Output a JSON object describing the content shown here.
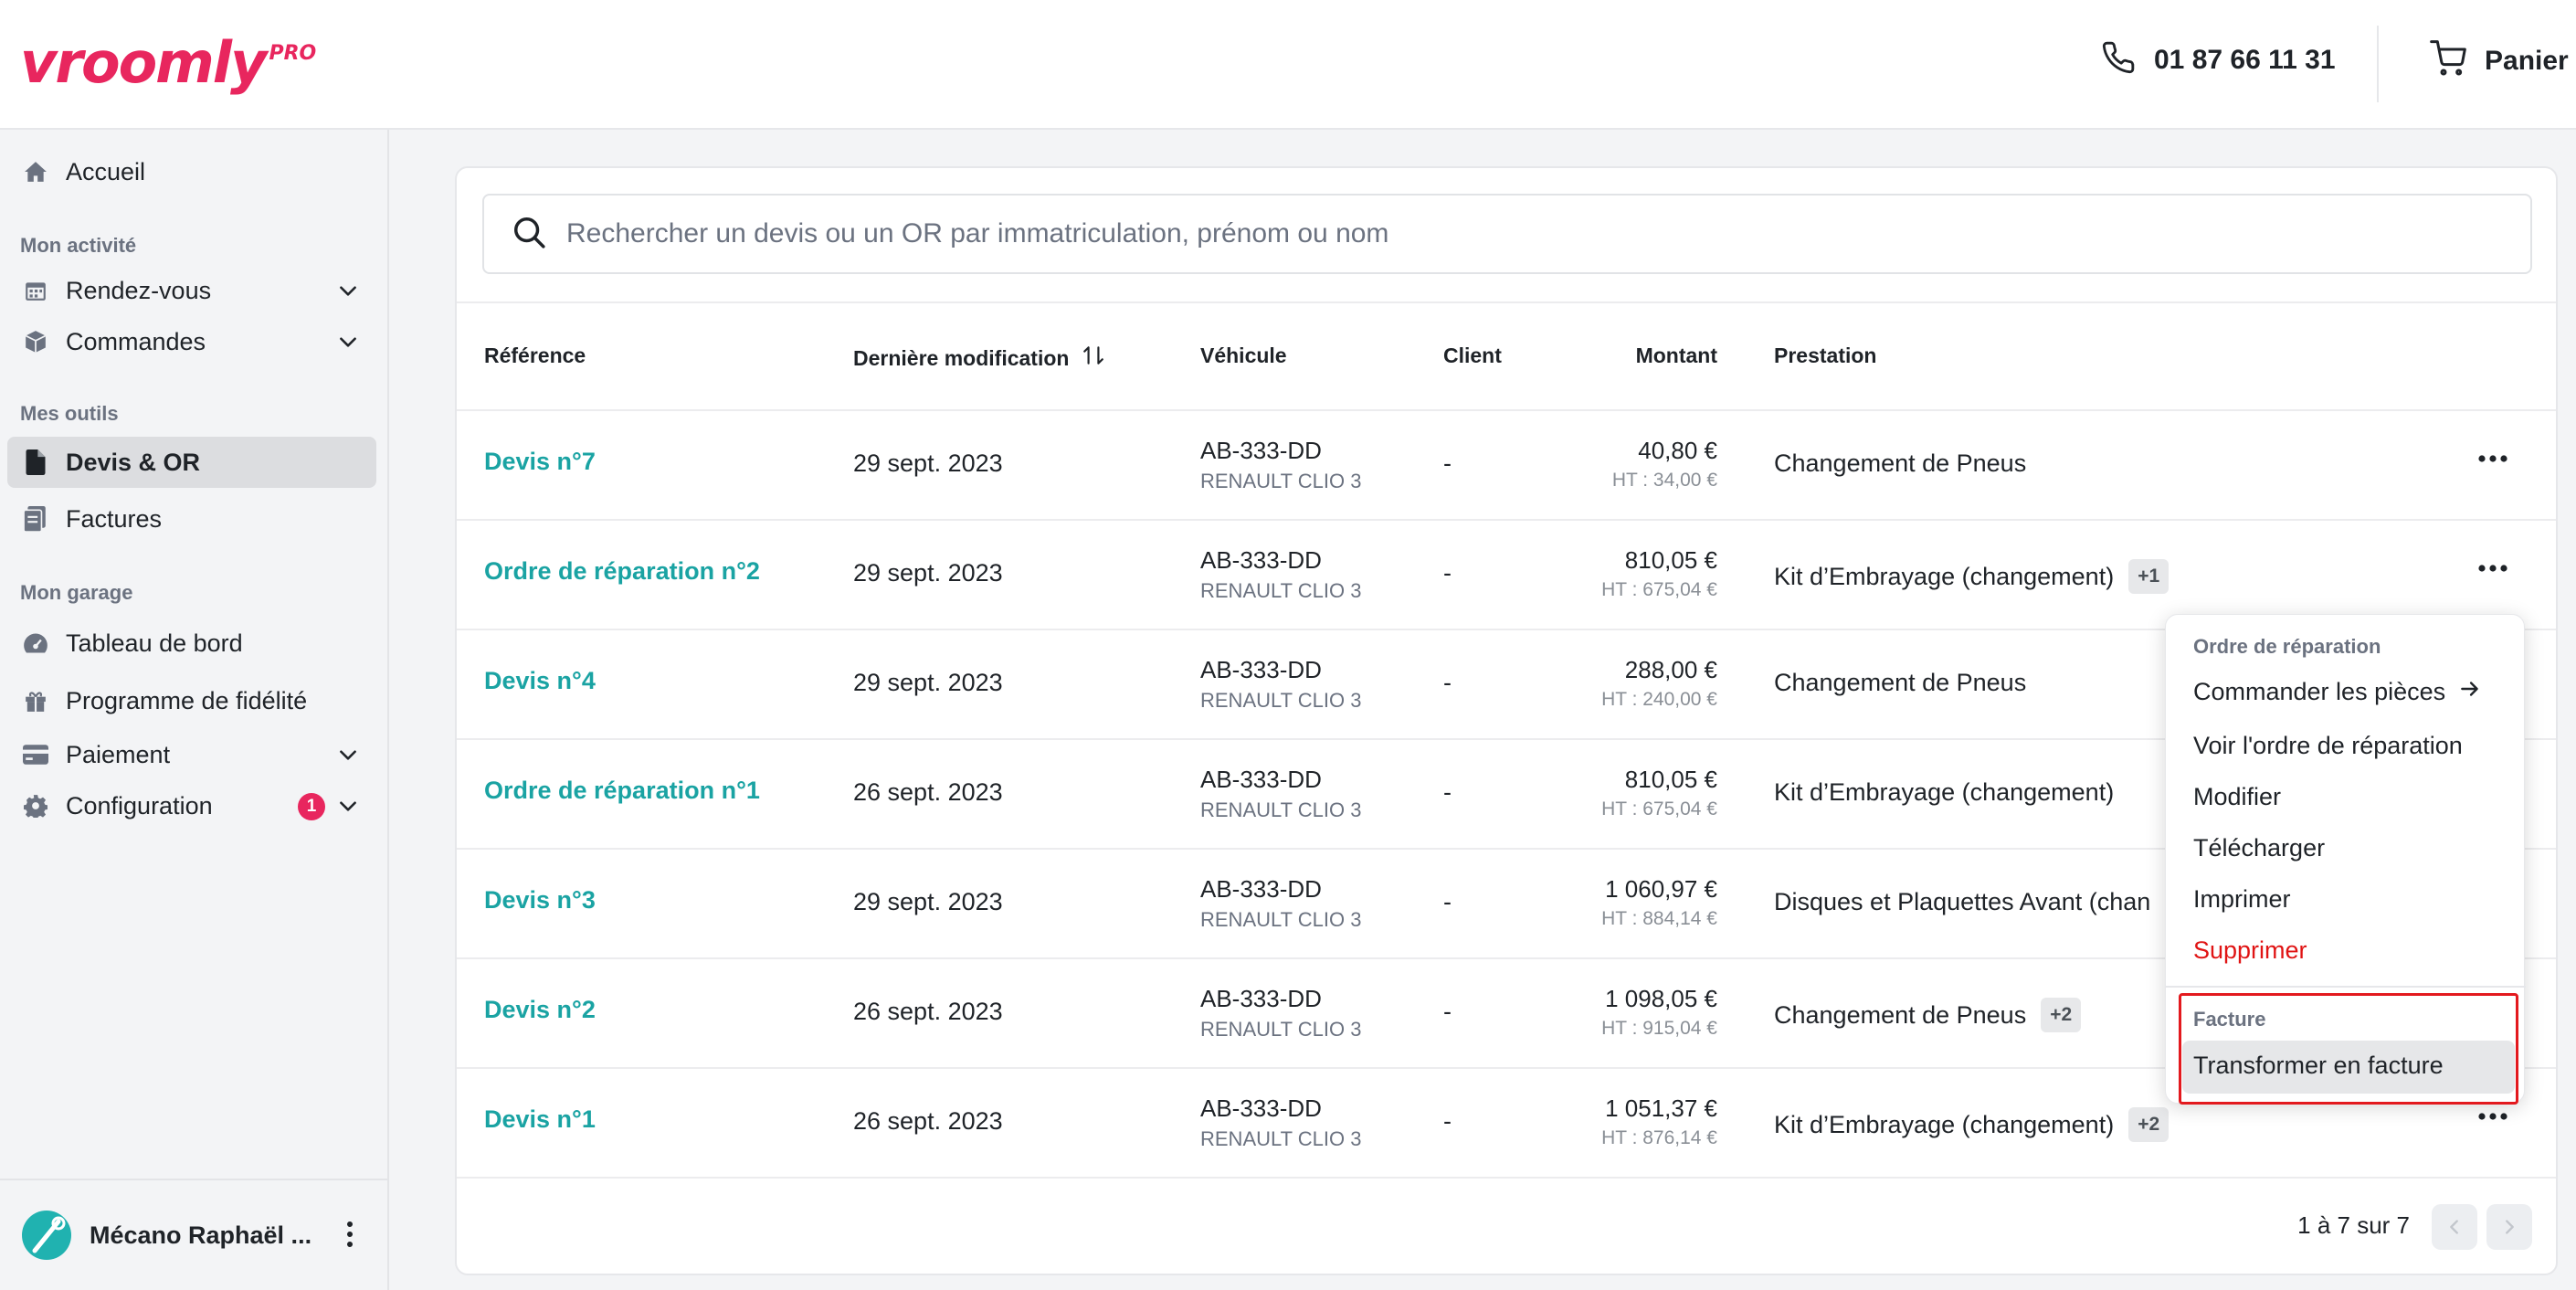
{
  "brand": {
    "name": "vroomly",
    "suffix": "PRO",
    "color": "#e8265e"
  },
  "header": {
    "phone": "01 87 66 11 31",
    "cart_label": "Panier"
  },
  "sidebar": {
    "home": "Accueil",
    "section_activity": "Mon activité",
    "appointments": "Rendez-vous",
    "orders": "Commandes",
    "section_tools": "Mes outils",
    "quotes": "Devis & OR",
    "invoices": "Factures",
    "section_garage": "Mon garage",
    "dashboard": "Tableau de bord",
    "loyalty": "Programme de fidélité",
    "payment": "Paiement",
    "configuration": "Configuration",
    "configuration_badge": "1",
    "user_name": "Mécano Raphaël ..."
  },
  "search": {
    "placeholder": "Rechercher un devis ou un OR par immatriculation, prénom ou nom"
  },
  "table": {
    "headers": {
      "reference": "Référence",
      "last_modified": "Dernière modification",
      "vehicle": "Véhicule",
      "client": "Client",
      "amount": "Montant",
      "service": "Prestation"
    },
    "rows": [
      {
        "ref": "Devis n°7",
        "date": "29 sept. 2023",
        "plate": "AB-333-DD",
        "model": "RENAULT CLIO 3",
        "client": "-",
        "amount": "40,80 €",
        "ht": "HT : 34,00 €",
        "service": "Changement de Pneus",
        "extra": ""
      },
      {
        "ref": "Ordre de réparation n°2",
        "date": "29 sept. 2023",
        "plate": "AB-333-DD",
        "model": "RENAULT CLIO 3",
        "client": "-",
        "amount": "810,05 €",
        "ht": "HT : 675,04 €",
        "service": "Kit d’Embrayage (changement)",
        "extra": "+1"
      },
      {
        "ref": "Devis n°4",
        "date": "29 sept. 2023",
        "plate": "AB-333-DD",
        "model": "RENAULT CLIO 3",
        "client": "-",
        "amount": "288,00 €",
        "ht": "HT : 240,00 €",
        "service": "Changement de Pneus",
        "extra": ""
      },
      {
        "ref": "Ordre de réparation n°1",
        "date": "26 sept. 2023",
        "plate": "AB-333-DD",
        "model": "RENAULT CLIO 3",
        "client": "-",
        "amount": "810,05 €",
        "ht": "HT : 675,04 €",
        "service": "Kit d’Embrayage (changement)",
        "extra": ""
      },
      {
        "ref": "Devis n°3",
        "date": "29 sept. 2023",
        "plate": "AB-333-DD",
        "model": "RENAULT CLIO 3",
        "client": "-",
        "amount": "1 060,97 €",
        "ht": "HT : 884,14 €",
        "service": "Disques et Plaquettes Avant (chan",
        "extra": ""
      },
      {
        "ref": "Devis n°2",
        "date": "26 sept. 2023",
        "plate": "AB-333-DD",
        "model": "RENAULT CLIO 3",
        "client": "-",
        "amount": "1 098,05 €",
        "ht": "HT : 915,04 €",
        "service": "Changement de Pneus",
        "extra": "+2"
      },
      {
        "ref": "Devis n°1",
        "date": "26 sept. 2023",
        "plate": "AB-333-DD",
        "model": "RENAULT CLIO 3",
        "client": "-",
        "amount": "1 051,37 €",
        "ht": "HT : 876,14 €",
        "service": "Kit d’Embrayage (changement)",
        "extra": "+2"
      }
    ]
  },
  "pagination": {
    "label": "1 à 7 sur 7"
  },
  "menu": {
    "section_repair": "Ordre de réparation",
    "order_parts": "Commander les pièces",
    "view_order": "Voir l'ordre de réparation",
    "edit": "Modifier",
    "download": "Télécharger",
    "print": "Imprimer",
    "delete": "Supprimer",
    "section_invoice": "Facture",
    "to_invoice": "Transformer en facture"
  }
}
